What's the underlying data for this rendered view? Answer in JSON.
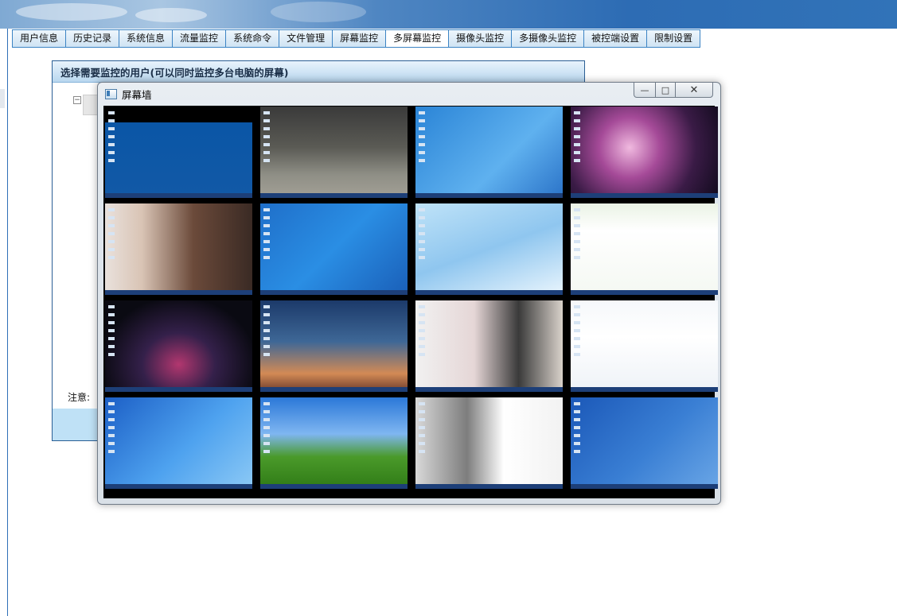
{
  "nav": {
    "tabs": [
      "用户信息",
      "历史记录",
      "系统信息",
      "流量监控",
      "系统命令",
      "文件管理",
      "屏幕监控",
      "多屏幕监控",
      "摄像头监控",
      "多摄像头监控",
      "被控端设置",
      "限制设置"
    ],
    "active_index": 7
  },
  "user_panel": {
    "title": "选择需要监控的用户(可以同时监控多台电脑的屏幕)",
    "tree_toggle": "⊟",
    "notice_label": "注意:"
  },
  "window": {
    "title": "屏幕墙",
    "minimize_glyph": "—",
    "maximize_glyph": "□",
    "close_glyph": "✕"
  },
  "screens": [
    {
      "name": "screen-1",
      "background": "linear-gradient(#000 0 20px,#0a56a6 20px,#1259a6 100%)",
      "icon": "desktop-icon"
    },
    {
      "name": "screen-2",
      "background": "linear-gradient(180deg,#3a3a3a 0%,#5b5b55 45%,#8f8f86 75%,#a3a096 100%)",
      "icon": "duck-wallpaper-icon"
    },
    {
      "name": "screen-3",
      "background": "linear-gradient(135deg,#2a84d6,#5fb1ef 60%,#2b73c8)",
      "icon": "windows-dialog-icon"
    },
    {
      "name": "screen-4",
      "background": "radial-gradient(circle at 40% 45%,#f0b9df 0%,#a54a98 30%,#3a1b46 65%,#100a1c 100%)",
      "icon": "nebula-wallpaper-icon"
    },
    {
      "name": "screen-5",
      "background": "linear-gradient(90deg,#e9e1dc 0%,#d9c4b5 25%,#6b4a3a 60%,#3a2a24 100%)",
      "icon": "portrait-wallpaper-icon"
    },
    {
      "name": "screen-6",
      "background": "linear-gradient(135deg,#1f6fc9,#2a8ee4 50%,#1a5fb8)",
      "icon": "explorer-window-icon"
    },
    {
      "name": "screen-7",
      "background": "linear-gradient(160deg,#bfe3f8,#8fc6ef 50%,#e9f5fd)",
      "icon": "anime-wallpaper-icon"
    },
    {
      "name": "screen-8",
      "background": "linear-gradient(#eaf3e5,#ffffff 30%,#f4f8f2)",
      "icon": "browser-page-icon"
    },
    {
      "name": "screen-9",
      "background": "radial-gradient(ellipse at 50% 70%,#b2376f 0%,#34204a 35%,#0a0a12 75%)",
      "icon": "swirl-wallpaper-icon"
    },
    {
      "name": "screen-10",
      "background": "linear-gradient(#1c3a6a 0%,#3e6796 45%,#d38a55 80%,#6b3a2a 100%)",
      "icon": "lighthouse-wallpaper-icon"
    },
    {
      "name": "screen-11",
      "background": "linear-gradient(90deg,#f1f1f1 0%,#e5d6d6 40%,#3a3a3a 70%,#d9d2cb 100%)",
      "icon": "chat-window-icon"
    },
    {
      "name": "screen-12",
      "background": "linear-gradient(#f6f8fb,#ffffff 40%,#eef2f7)",
      "icon": "settings-window-icon"
    },
    {
      "name": "screen-13",
      "background": "linear-gradient(135deg,#1c5fc6,#4ea2ef 55%,#8cc9f5)",
      "icon": "desktop-icon"
    },
    {
      "name": "screen-14",
      "background": "linear-gradient(#2b78d8 0%,#7fb6f1 40%,#4a9a2a 65%,#2f7a16 100%)",
      "icon": "bliss-wallpaper-icon"
    },
    {
      "name": "screen-15",
      "background": "linear-gradient(90deg,#d9d9d9 0%,#7d7d7d 35%,#ffffff 60%,#f2f2f2 100%)",
      "icon": "nested-desktop-icon"
    },
    {
      "name": "screen-16",
      "background": "linear-gradient(135deg,#1b58b8,#3a7fd4 55%,#6aa6e6)",
      "icon": "xp-dialogs-icon"
    }
  ]
}
